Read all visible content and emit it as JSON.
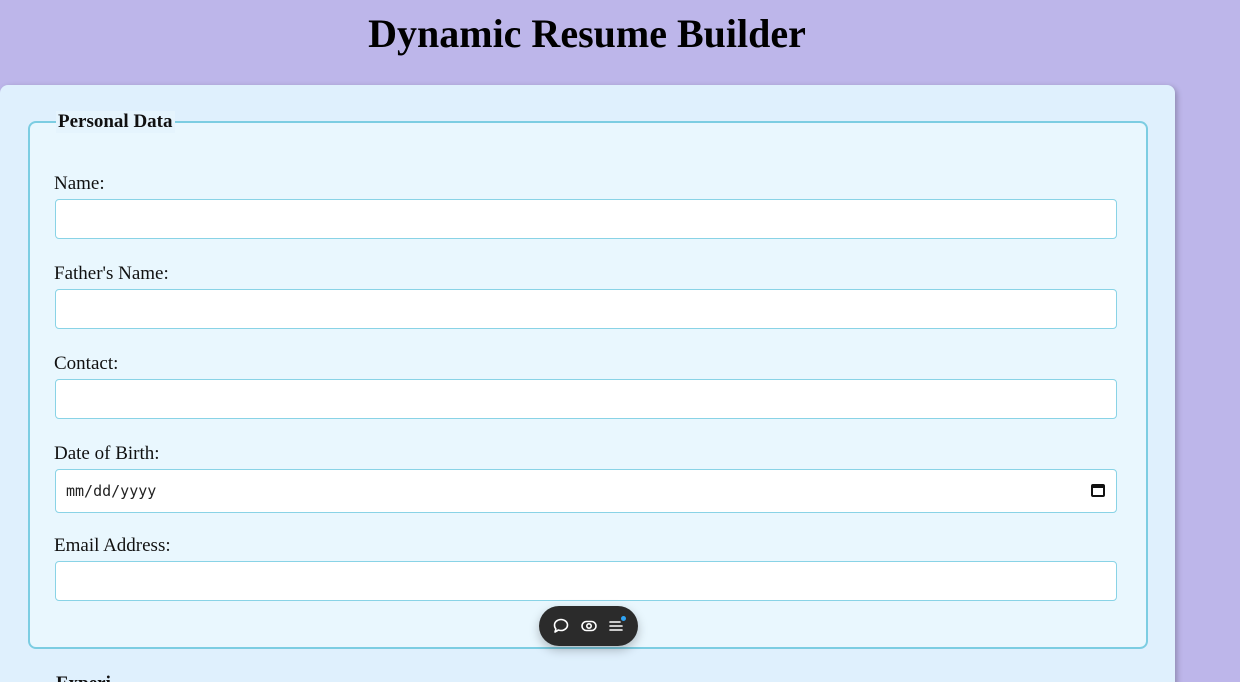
{
  "page": {
    "title": "Dynamic Resume Builder"
  },
  "personal": {
    "legend": "Personal Data",
    "fields": {
      "name": {
        "label": "Name:",
        "value": ""
      },
      "father": {
        "label": "Father's Name:",
        "value": ""
      },
      "contact": {
        "label": "Contact:",
        "value": ""
      },
      "dob": {
        "label": "Date of Birth:",
        "placeholder": "mm/dd/yyyy"
      },
      "email": {
        "label": "Email Address:",
        "value": ""
      }
    }
  },
  "next_section": {
    "legend_partial": "Experi"
  },
  "toolbar": {
    "icons": [
      "chat-bubble-icon",
      "eye-toggle-icon",
      "menu-list-icon"
    ],
    "notify_color": "#2fa4f5"
  },
  "colors": {
    "background": "#bdb6ea",
    "card": "#dff0fd",
    "fieldset_border": "#7ccde2",
    "input_border": "#89d3e6"
  }
}
